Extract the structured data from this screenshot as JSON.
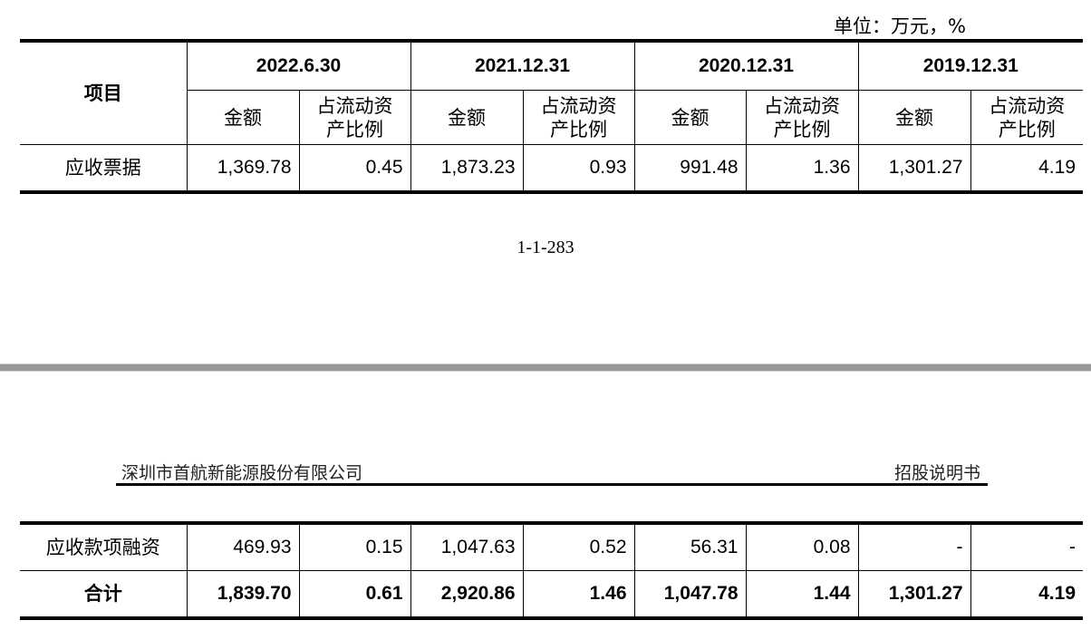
{
  "unit_label": "单位：万元，%",
  "table": {
    "item_header": "项目",
    "periods": [
      "2022.6.30",
      "2021.12.31",
      "2020.12.31",
      "2019.12.31"
    ],
    "sub_headers": {
      "amount": "金额",
      "ratio": "占流动资产比例",
      "ratio_line1": "占流动资",
      "ratio_line2": "产比例"
    },
    "rows": [
      {
        "label": "应收票据",
        "values": [
          "1,369.78",
          "0.45",
          "1,873.23",
          "0.93",
          "991.48",
          "1.36",
          "1,301.27",
          "4.19"
        ]
      },
      {
        "label": "应收款项融资",
        "values": [
          "469.93",
          "0.15",
          "1,047.63",
          "0.52",
          "56.31",
          "0.08",
          "-",
          "-"
        ]
      },
      {
        "label": "合计",
        "values": [
          "1,839.70",
          "0.61",
          "2,920.86",
          "1.46",
          "1,047.78",
          "1.44",
          "1,301.27",
          "4.19"
        ]
      }
    ]
  },
  "page_number": "1-1-283",
  "doc_header": {
    "company": "深圳市首航新能源股份有限公司",
    "doc_type": "招股说明书"
  }
}
